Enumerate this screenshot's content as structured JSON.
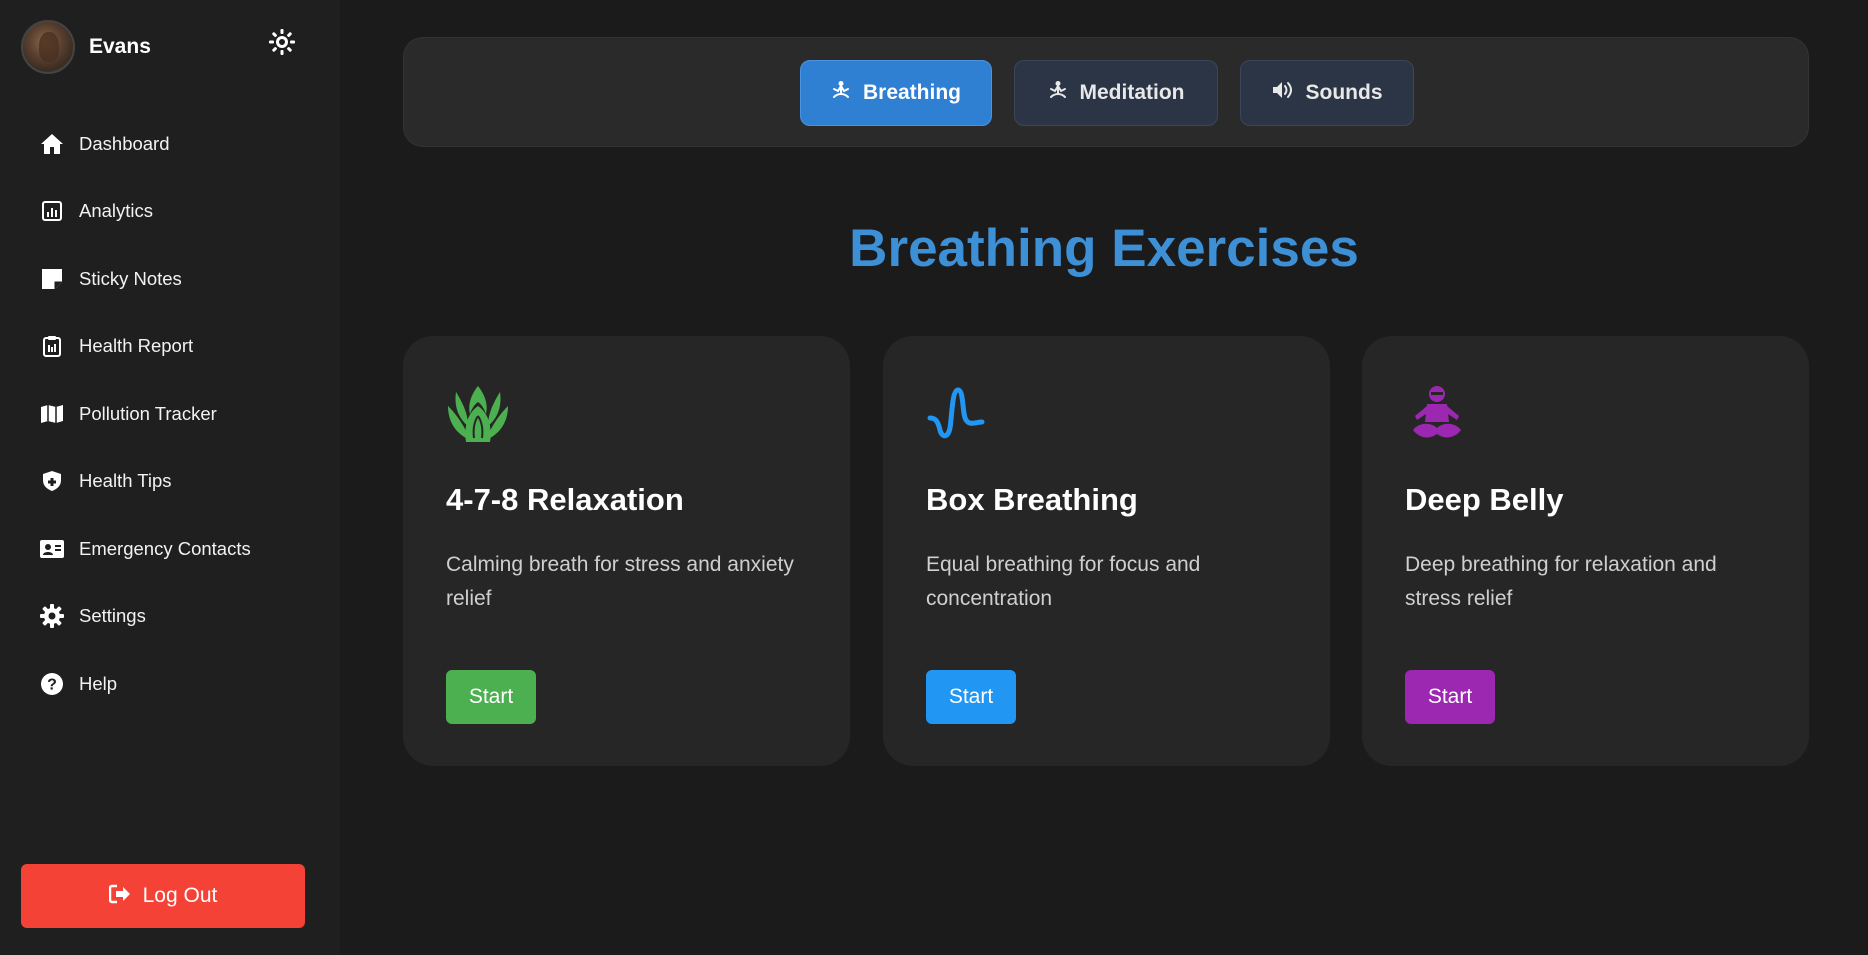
{
  "profile": {
    "name": "Evans"
  },
  "sidebar": {
    "items": [
      {
        "label": "Dashboard",
        "icon": "home-icon"
      },
      {
        "label": "Analytics",
        "icon": "chart-icon"
      },
      {
        "label": "Sticky Notes",
        "icon": "sticky-note-icon"
      },
      {
        "label": "Health Report",
        "icon": "clipboard-icon"
      },
      {
        "label": "Pollution Tracker",
        "icon": "map-icon"
      },
      {
        "label": "Health Tips",
        "icon": "shield-icon"
      },
      {
        "label": "Emergency Contacts",
        "icon": "contact-card-icon"
      },
      {
        "label": "Settings",
        "icon": "gear-icon"
      },
      {
        "label": "Help",
        "icon": "question-icon"
      }
    ],
    "logout_label": "Log Out"
  },
  "tabs": [
    {
      "label": "Breathing",
      "active": true,
      "icon": "meditation-icon"
    },
    {
      "label": "Meditation",
      "active": false,
      "icon": "meditation-icon"
    },
    {
      "label": "Sounds",
      "active": false,
      "icon": "volume-icon"
    }
  ],
  "section_title": "Breathing Exercises",
  "cards": [
    {
      "title": "4-7-8 Relaxation",
      "description": "Calming breath for stress and anxiety relief",
      "button": "Start",
      "icon": "lotus-icon",
      "color": "#4caf50"
    },
    {
      "title": "Box Breathing",
      "description": "Equal breathing for focus and concentration",
      "button": "Start",
      "icon": "wave-icon",
      "color": "#2196f3"
    },
    {
      "title": "Deep Belly",
      "description": "Deep breathing for relaxation and stress relief",
      "button": "Start",
      "icon": "meditation-person-icon",
      "color": "#9c27b0"
    }
  ],
  "colors": {
    "background": "#1b1b1b",
    "sidebar": "#1f1f1f",
    "accent_blue": "#3d8fd6",
    "logout_red": "#f44336"
  }
}
